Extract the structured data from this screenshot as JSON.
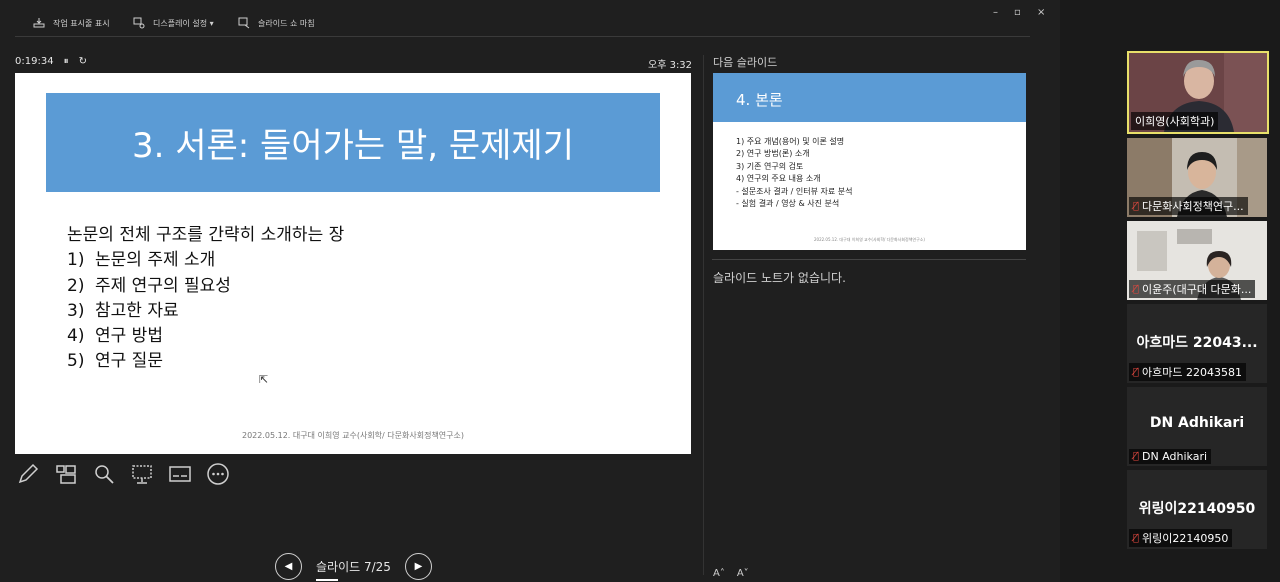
{
  "toolbar": {
    "taskbar_label": "작업 표시줄 표시",
    "display_settings_label": "디스플레이 설정 ▾",
    "end_show_label": "슬라이드 쇼 마침",
    "minimize": "–",
    "restore": "▫",
    "close": "×"
  },
  "timer": {
    "elapsed": "0:19:34",
    "pause": "⏸",
    "reset": "↻"
  },
  "clock": "오후 3:32",
  "slide": {
    "title": "3. 서론: 들어가는 말, 문제제기",
    "intro": "논문의 전체 구조를 간략히 소개하는 장",
    "items": [
      {
        "num": "1)",
        "text": "논문의 주제 소개"
      },
      {
        "num": "2)",
        "text": "주제 연구의 필요성"
      },
      {
        "num": "3)",
        "text": "참고한 자료"
      },
      {
        "num": "4)",
        "text": "연구 방법"
      },
      {
        "num": "5)",
        "text": "연구 질문"
      }
    ],
    "footer": "2022.05.12. 대구대 이희영 교수(사회학/ 다문화사회정책연구소)"
  },
  "navigation": {
    "label": "슬라이드 7/25"
  },
  "next_slide": {
    "header": "다음 슬라이드",
    "title": "4. 본론",
    "lines": [
      "1)  주요 개념(용어) 및 이론 설명",
      "2)  연구 방법(론) 소개",
      "3)  기존 연구의 검토",
      "4)  연구의 주요 내용 소개",
      "- 설문조사 결과 / 인터뷰 자료 분석",
      "- 실험 결과 / 영상 & 사진 분석"
    ],
    "footer": "2022.05.12. 대구대 이희영 교수(사회학/ 다문화사회정책연구소)"
  },
  "notes": "슬라이드 노트가 없습니다.",
  "font_controls": {
    "increase": "A˄",
    "decrease": "A˅"
  },
  "participants": [
    {
      "name": "이희영(사회학과)",
      "muted": false
    },
    {
      "name": "다문화사회정책연구...",
      "muted": true
    },
    {
      "name": "이윤주(대구대 다문화...",
      "muted": true
    },
    {
      "display": "아흐마드 22043...",
      "name": "아흐마드 22043581",
      "muted": true
    },
    {
      "display": "DN Adhikari",
      "name": "DN Adhikari",
      "muted": true
    },
    {
      "display": "위링이22140950",
      "name": "위링이22140950",
      "muted": true
    }
  ],
  "colors": {
    "accent_blue": "#5b9bd5",
    "active_speaker": "#e8e06a",
    "muted_red": "#e0483f"
  }
}
